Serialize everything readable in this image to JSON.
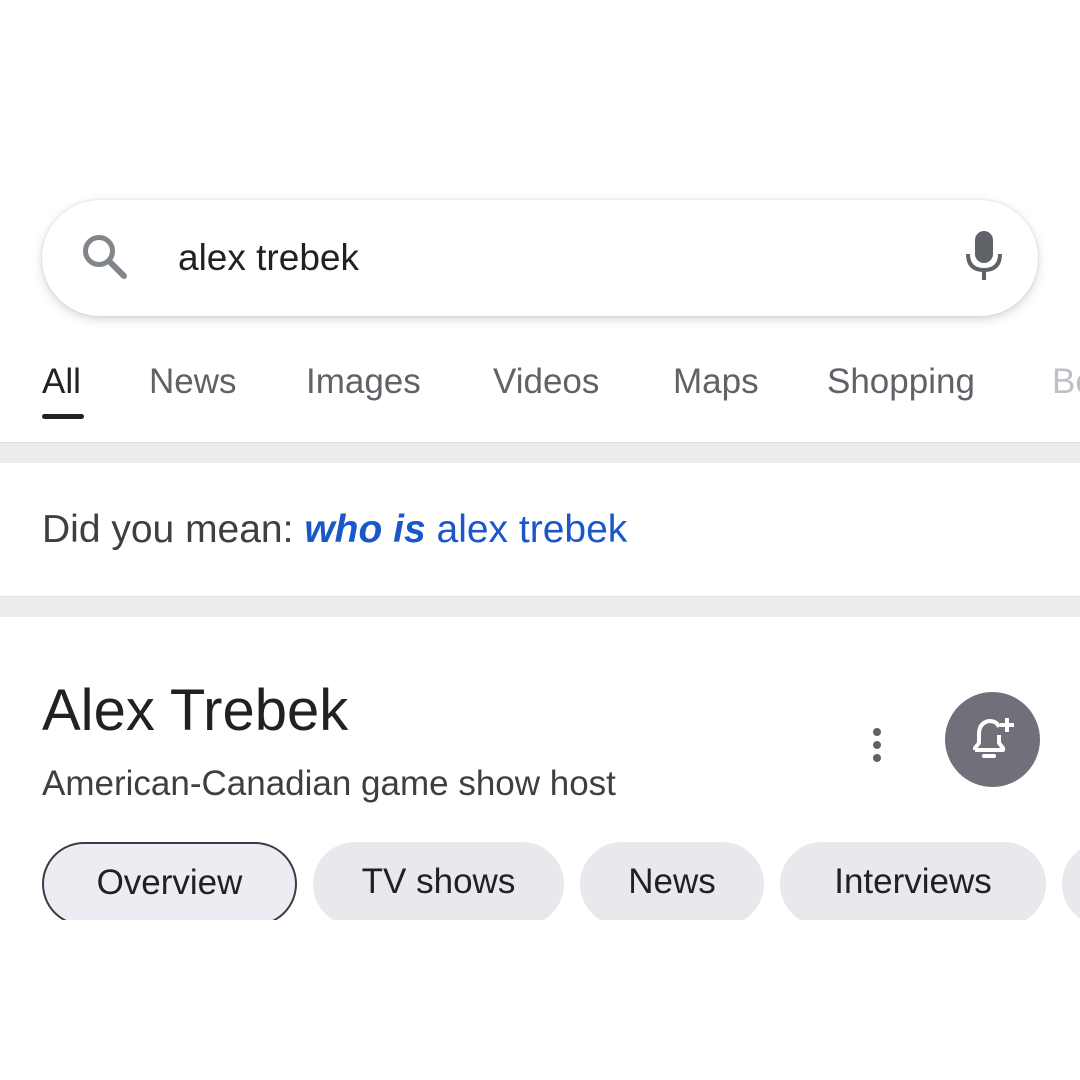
{
  "search": {
    "query": "alex trebek",
    "icon": "search-icon",
    "voice_icon": "mic-icon"
  },
  "tabs": [
    {
      "label": "All",
      "active": true
    },
    {
      "label": "News",
      "active": false
    },
    {
      "label": "Images",
      "active": false
    },
    {
      "label": "Videos",
      "active": false
    },
    {
      "label": "Maps",
      "active": false
    },
    {
      "label": "Shopping",
      "active": false
    },
    {
      "label": "Bo",
      "active": false
    }
  ],
  "did_you_mean": {
    "prefix": "Did you mean:",
    "emphasis": "who is",
    "suggestion": "alex trebek"
  },
  "knowledge_panel": {
    "title": "Alex Trebek",
    "subtitle": "American-Canadian game show host",
    "chips": [
      {
        "label": "Overview",
        "selected": true
      },
      {
        "label": "TV shows",
        "selected": false
      },
      {
        "label": "News",
        "selected": false
      },
      {
        "label": "Interviews",
        "selected": false
      }
    ]
  },
  "colors": {
    "link": "#1a57c9",
    "text": "#202124",
    "muted": "#5f6368",
    "follow_button": "#70707a"
  }
}
